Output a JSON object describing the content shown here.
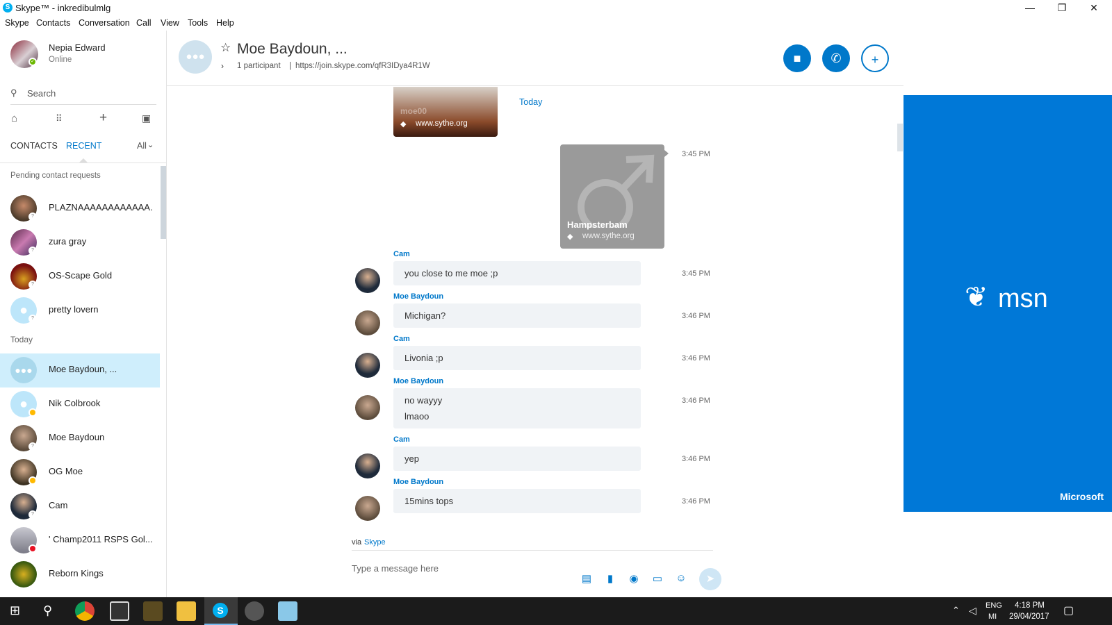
{
  "window": {
    "title": "Skype™ - inkredibulmlg",
    "logo": "S",
    "controls": {
      "minimize": "—",
      "maximize": "❐",
      "close": "✕"
    }
  },
  "menu": [
    "Skype",
    "Contacts",
    "Conversation",
    "Call",
    "View",
    "Tools",
    "Help"
  ],
  "profile": {
    "name": "Nepia Edward",
    "status": "Online"
  },
  "search": {
    "placeholder": "Search"
  },
  "tabs": {
    "contacts": "CONTACTS",
    "recent": "RECENT",
    "filter": "All"
  },
  "pending": {
    "header": "Pending contact requests",
    "items": [
      {
        "name": "PLAZNAAAAAAAAAAAA..."
      },
      {
        "name": "zura gray"
      },
      {
        "name": "OS-Scape Gold"
      },
      {
        "name": "pretty lovern"
      }
    ]
  },
  "recent": {
    "header": "Today",
    "items": [
      {
        "name": "Moe Baydoun, ..."
      },
      {
        "name": "Nik Colbrook"
      },
      {
        "name": "Moe Baydoun"
      },
      {
        "name": "OG Moe"
      },
      {
        "name": "Cam"
      },
      {
        "name": "' Champ2011 RSPS Gol..."
      },
      {
        "name": "Reborn Kings"
      }
    ]
  },
  "chat": {
    "title": "Moe Baydoun, ...",
    "participants": "1 participant",
    "separator": "|",
    "join_link": "https://join.skype.com/qfR3IDya4R1W",
    "date_marker": "Today",
    "link_preview_top": {
      "site": "www.sythe.org",
      "name": "moe00"
    },
    "link_preview": {
      "title": "Hampsterbam",
      "site": "www.sythe.org",
      "time": "3:45 PM"
    },
    "messages": [
      {
        "sender": "Cam",
        "text": "you close to me moe ;p",
        "time": "3:45 PM"
      },
      {
        "sender": "Moe Baydoun",
        "text": "Michigan?",
        "time": "3:46 PM"
      },
      {
        "sender": "Cam",
        "text": "Livonia ;p",
        "time": "3:46 PM"
      },
      {
        "sender": "Moe Baydoun",
        "text": "no wayyy",
        "text2": "lmaoo",
        "time": "3:46 PM"
      },
      {
        "sender": "Cam",
        "text": "yep",
        "time": "3:46 PM"
      },
      {
        "sender": "Moe Baydoun",
        "text": "15mins tops",
        "time": "3:46 PM"
      }
    ],
    "via_label": "via",
    "via_app": "Skype",
    "composer_placeholder": "Type a message here"
  },
  "ad": {
    "brand": "msn",
    "footer": "Microsoft"
  },
  "taskbar": {
    "lang1": "ENG",
    "lang2": "MI",
    "time": "4:18 PM",
    "date": "29/04/2017"
  },
  "colors": {
    "accent": "#0078ca",
    "selected": "#cfeefc",
    "ad_bg": "#0078d7"
  }
}
